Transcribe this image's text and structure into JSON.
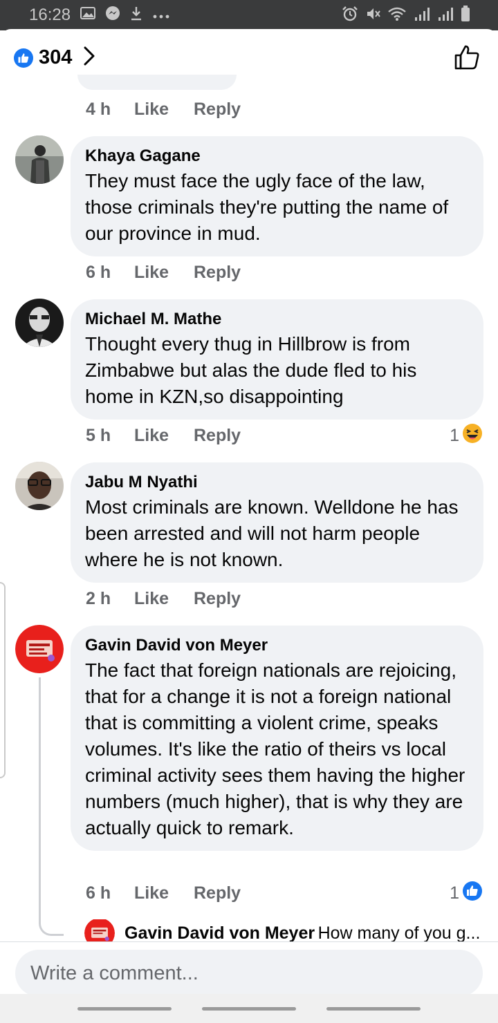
{
  "status_bar": {
    "time": "16:28",
    "left_icons": [
      "gallery-icon",
      "messenger-icon",
      "download-icon",
      "more-icon"
    ],
    "right_icons": [
      "alarm-icon",
      "mute-icon",
      "wifi-icon",
      "signal-icon",
      "signal-icon",
      "battery-icon"
    ]
  },
  "header": {
    "reaction_count": "304",
    "reaction_icon": "like-icon"
  },
  "colors": {
    "accent": "#1877f2",
    "bubble": "#f0f2f5",
    "meta_text": "#65676b"
  },
  "comments": [
    {
      "author": "",
      "text": "",
      "time": "4 h",
      "like_label": "Like",
      "reply_label": "Reply"
    },
    {
      "author": "Khaya Gagane",
      "text": "They must face the ugly face of the law, those criminals they're putting the name of our province in mud.",
      "time": "6 h",
      "like_label": "Like",
      "reply_label": "Reply"
    },
    {
      "author": "Michael M. Mathe",
      "text": "Thought every thug in Hillbrow is from Zimbabwe but alas the dude fled to his home in KZN,so disappointing",
      "time": "5 h",
      "like_label": "Like",
      "reply_label": "Reply",
      "reaction_count": "1",
      "reaction_icon": "laughing-emoji-icon"
    },
    {
      "author": "Jabu M Nyathi",
      "text": "Most criminals are known. Welldone he has been arrested and will not harm people where he is not known.",
      "time": "2 h",
      "like_label": "Like",
      "reply_label": "Reply"
    },
    {
      "author": "Gavin David von Meyer",
      "text": "The fact that foreign nationals are rejoicing, that for a change it is not a foreign national that is committing a violent crime, speaks volumes. It's like the ratio of theirs vs local criminal activity sees them having the higher numbers (much higher), that is why they are actually quick to remark.",
      "time": "6 h",
      "like_label": "Like",
      "reply_label": "Reply",
      "reaction_count": "1",
      "reaction_icon": "like-icon"
    }
  ],
  "reply_preview": {
    "author": "Gavin David von Meyer",
    "text": "How many of you g..."
  },
  "composer": {
    "placeholder": "Write a comment..."
  }
}
